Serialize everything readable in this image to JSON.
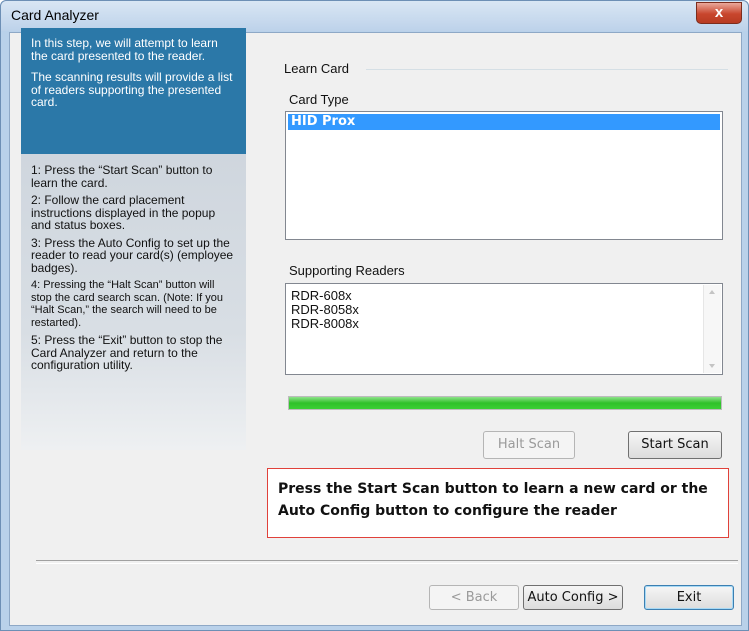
{
  "window": {
    "title": "Card Analyzer",
    "close_glyph": "x"
  },
  "instructions": {
    "intro": [
      "In this step, we will attempt to learn the card presented to the reader.",
      "The scanning results will provide a list of readers supporting the presented card."
    ],
    "steps": [
      "1: Press the “Start Scan” button to learn the card.",
      "2: Follow the card placement instructions displayed in the popup and status boxes.",
      "3: Press the Auto Config to set up the reader to read your card(s) (employee badges).",
      "4: Pressing the “Halt Scan” button will stop the card search scan. (Note: If you “Halt Scan,” the search will need to be restarted).",
      "5: Press the “Exit” button to stop the Card Analyzer and return to the configuration utility."
    ]
  },
  "learn_card": {
    "group_label": "Learn Card",
    "card_type_label": "Card Type",
    "card_types": [
      "HID Prox"
    ],
    "supporting_readers_label": "Supporting Readers",
    "readers": [
      "RDR-608x",
      "RDR-8058x",
      "RDR-8008x"
    ],
    "progress": 1.0,
    "halt_scan_label": "Halt Scan",
    "start_scan_label": "Start Scan"
  },
  "status": {
    "message": "Press the Start Scan button to learn a new card or the Auto Config button to configure the reader"
  },
  "footer": {
    "back_label": "< Back",
    "auto_config_label": "Auto Config >",
    "exit_label": "Exit"
  },
  "colors": {
    "info_panel": "#2b78a8",
    "selection": "#3399ff",
    "progress": "#2fc12a",
    "status_border": "#e0413a"
  }
}
